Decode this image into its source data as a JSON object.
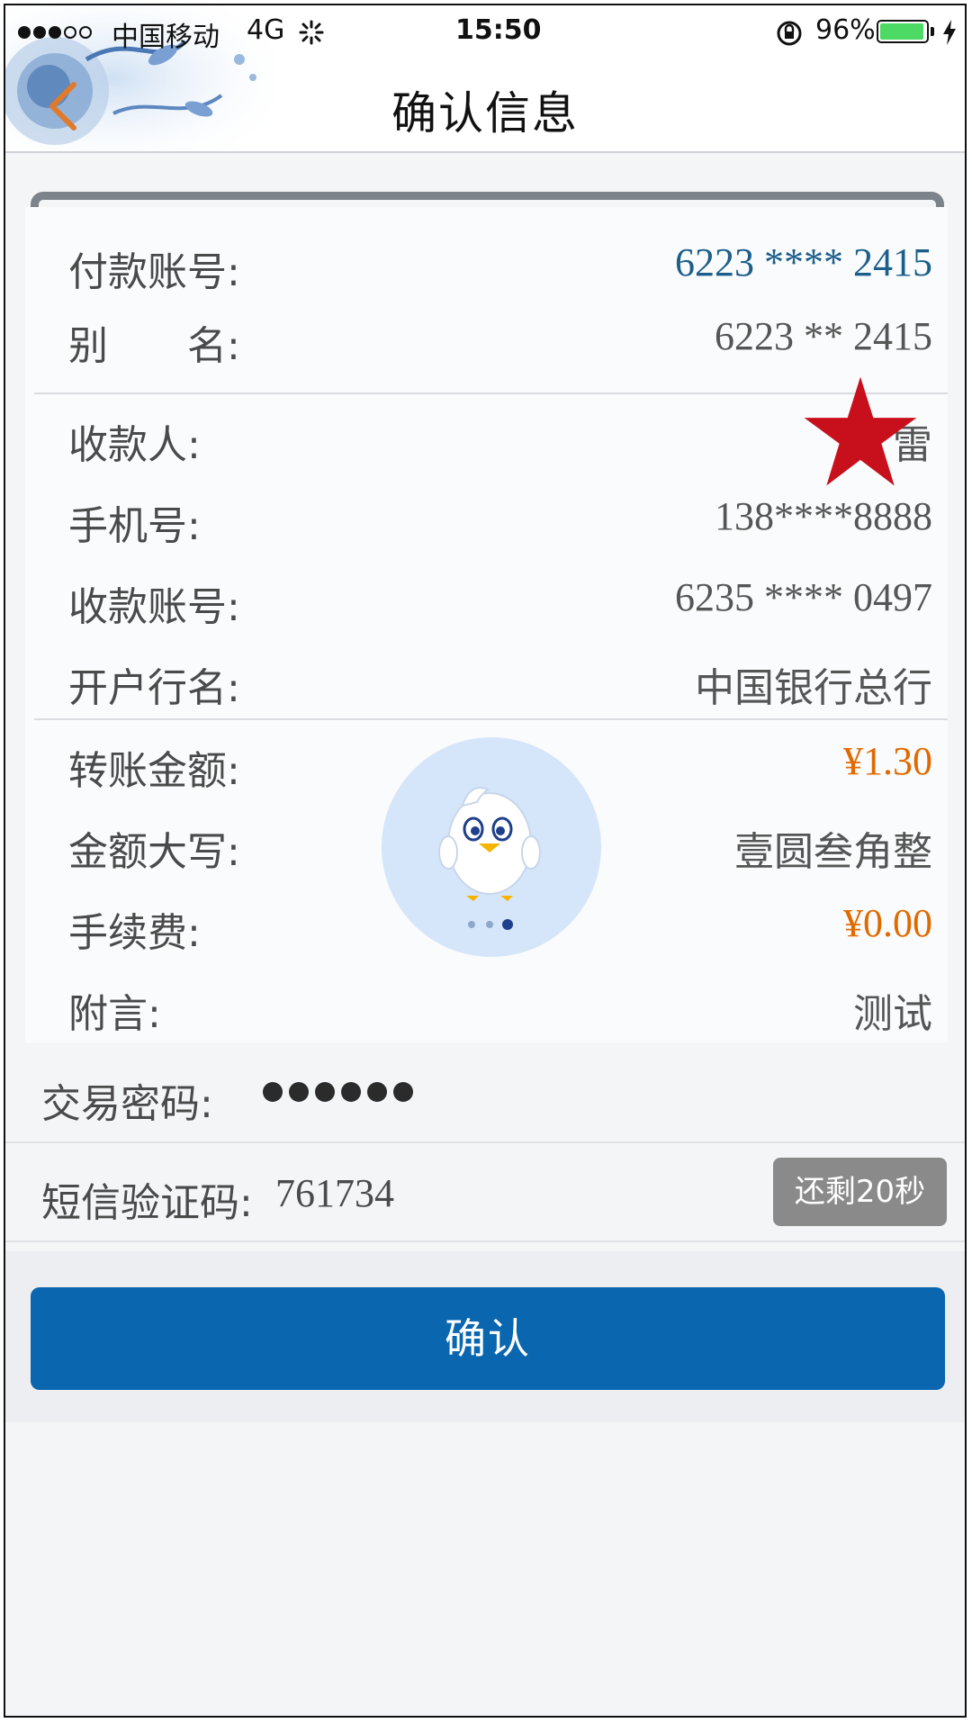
{
  "status_bar": {
    "carrier": "中国移动",
    "network": "4G",
    "time": "15:50",
    "battery": "96%",
    "battery_level": 0.96
  },
  "header": {
    "title": "确认信息"
  },
  "payer": {
    "account_label": "付款账号:",
    "account_value": "6223 **** 2415",
    "alias_label": "别　　名:",
    "alias_value": "6223 ** 2415"
  },
  "payee": {
    "name_label": "收款人:",
    "name_value": "雷",
    "phone_label": "手机号:",
    "phone_value": "138****8888",
    "account_label": "收款账号:",
    "account_value": "6235 **** 0497",
    "bank_label": "开户行名:",
    "bank_value": "中国银行总行"
  },
  "transfer": {
    "amount_label": "转账金额:",
    "amount_value": "¥1.30",
    "amount_upper_label": "金额大写:",
    "amount_upper_value": "壹圆叁角整",
    "fee_label": "手续费:",
    "fee_value": "¥0.00",
    "note_label": "附言:",
    "note_value": "测试"
  },
  "password": {
    "label": "交易密码:",
    "dots": 6
  },
  "sms": {
    "label": "短信验证码:",
    "code": "761734",
    "countdown": "还剩20秒"
  },
  "confirm_button": "确认",
  "colors": {
    "primary_button": "#0a66ae",
    "amount_orange": "#e06a00",
    "account_blue": "#1d5f8b",
    "countdown_gray": "#8a8a8a",
    "battery_green": "#4cd964"
  }
}
